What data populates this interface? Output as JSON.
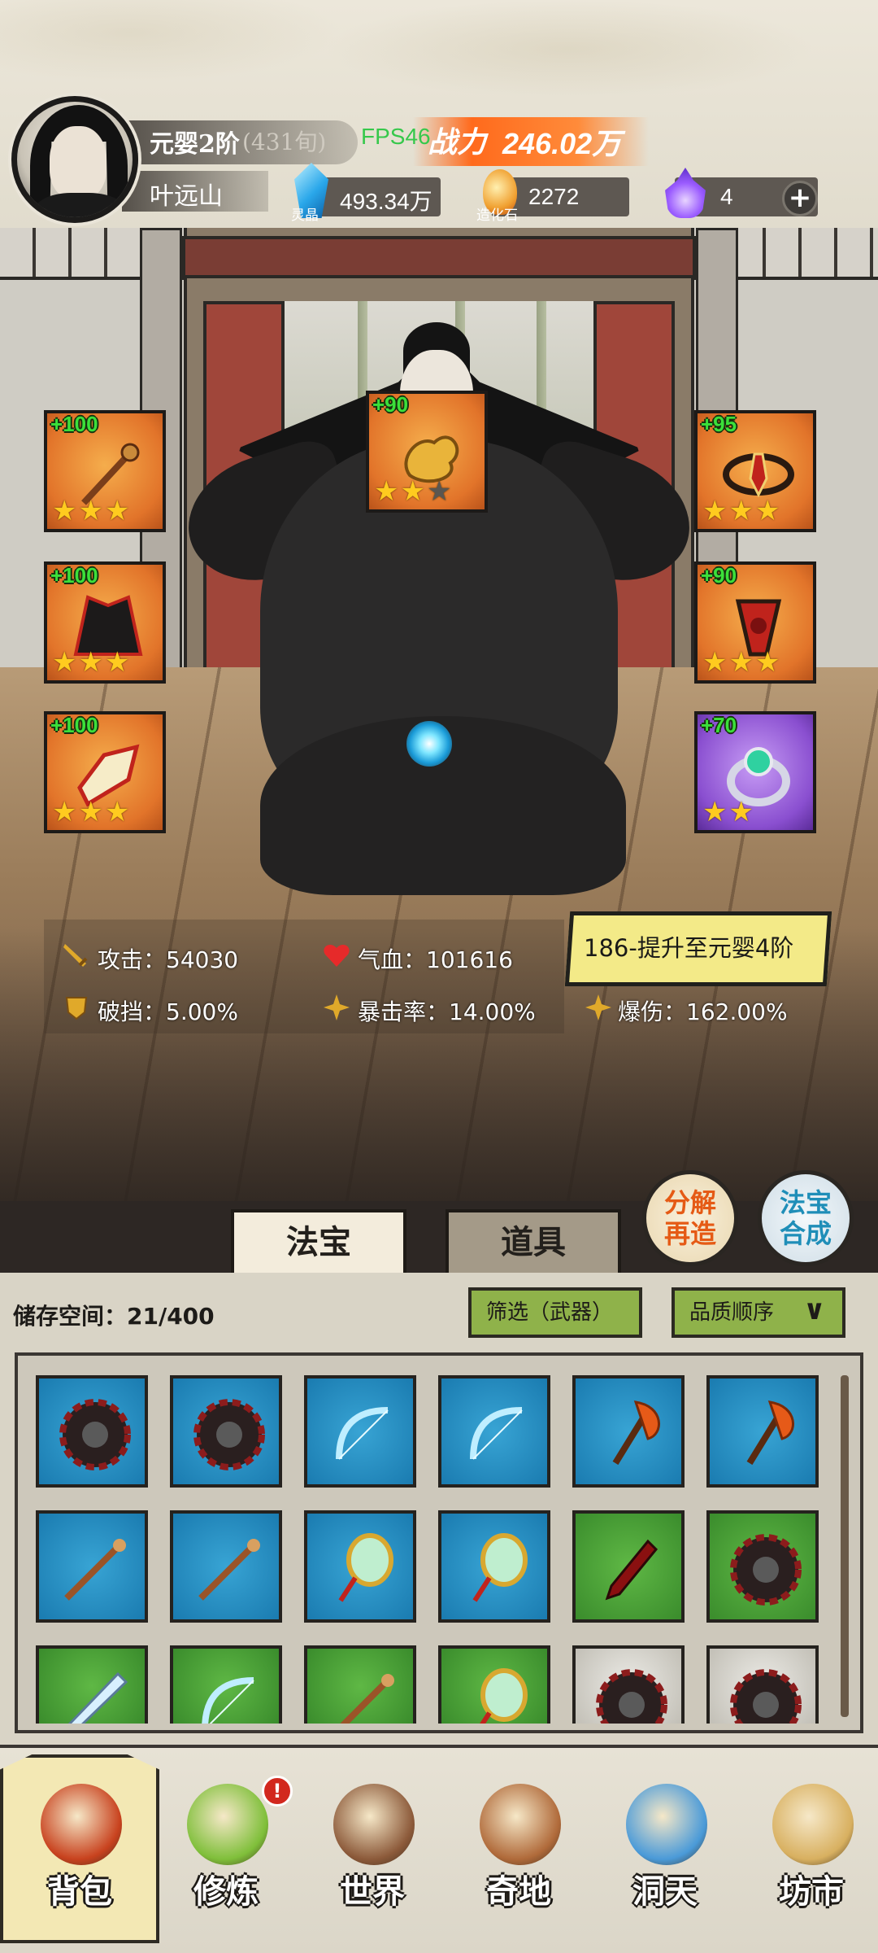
{
  "header": {
    "rank": "元婴2阶",
    "age": "(431旬)",
    "character_name": "叶远山",
    "fps": "FPS46",
    "power_label": "战力",
    "power_value": "246.02万",
    "resources": [
      {
        "icon": "spirit-crystal-icon",
        "caption": "灵晶",
        "value": "493.34万"
      },
      {
        "icon": "creation-stone-icon",
        "caption": "造化石",
        "value": "2272"
      },
      {
        "icon": "purple-flame-icon",
        "caption": "",
        "value": "4"
      }
    ],
    "add_label": "+"
  },
  "equipment": {
    "left": [
      {
        "level": "+100",
        "stars": 3,
        "max_stars": 3,
        "icon": "staff-icon"
      },
      {
        "level": "+100",
        "stars": 3,
        "max_stars": 3,
        "icon": "robe-icon"
      },
      {
        "level": "+100",
        "stars": 3,
        "max_stars": 3,
        "icon": "boots-icon"
      }
    ],
    "top": {
      "level": "+90",
      "stars": 2,
      "max_stars": 3,
      "icon": "golden-cloud-icon"
    },
    "right": [
      {
        "level": "+95",
        "stars": 3,
        "max_stars": 3,
        "icon": "crown-icon"
      },
      {
        "level": "+90",
        "stars": 3,
        "max_stars": 3,
        "icon": "amulet-icon"
      },
      {
        "level": "+70",
        "stars": 2,
        "max_stars": 2,
        "icon": "ring-icon"
      }
    ]
  },
  "stats": {
    "attack": "攻击：54030",
    "hp": "气血：101616",
    "break_block": "破挡：5.00%",
    "crit_rate": "暴击率：14.00%",
    "crit_dmg": "爆伤：162.00%"
  },
  "upgrade": {
    "label": "186-提升至元婴4阶"
  },
  "round_buttons": {
    "decompose": "分解\n再造",
    "synthesize": "法宝\n合成"
  },
  "tabs": {
    "treasure": "法宝",
    "items": "道具"
  },
  "bag": {
    "storage": "储存空间：21/400",
    "filter": "筛选（武器）",
    "sort": "品质顺序",
    "cells": [
      {
        "color": "blue",
        "icon": "dark-wheel-icon"
      },
      {
        "color": "blue",
        "icon": "dark-wheel-icon"
      },
      {
        "color": "blue",
        "icon": "ice-bow-icon"
      },
      {
        "color": "blue",
        "icon": "ice-bow-icon"
      },
      {
        "color": "blue",
        "icon": "fire-axe-icon"
      },
      {
        "color": "blue",
        "icon": "fire-axe-icon"
      },
      {
        "color": "blue",
        "icon": "bone-staff-icon"
      },
      {
        "color": "blue",
        "icon": "bone-staff-icon"
      },
      {
        "color": "blue",
        "icon": "jade-mirror-icon"
      },
      {
        "color": "blue",
        "icon": "jade-mirror-icon"
      },
      {
        "color": "green",
        "icon": "blood-dagger-icon"
      },
      {
        "color": "green",
        "icon": "dark-wheel-icon"
      },
      {
        "color": "green",
        "icon": "ice-sword-icon"
      },
      {
        "color": "green",
        "icon": "ice-bow-icon"
      },
      {
        "color": "green",
        "icon": "bone-staff-icon"
      },
      {
        "color": "green",
        "icon": "jade-mirror-icon"
      },
      {
        "color": "gray",
        "icon": "dark-wheel-icon"
      },
      {
        "color": "gray",
        "icon": "dark-wheel-icon"
      }
    ]
  },
  "nav": [
    {
      "label": "背包",
      "icon": "backpack-icon",
      "active": true,
      "badge": ""
    },
    {
      "label": "修炼",
      "icon": "cultivation-flower-icon",
      "active": false,
      "badge": "!"
    },
    {
      "label": "世界",
      "icon": "world-scroll-icon",
      "active": false,
      "badge": ""
    },
    {
      "label": "奇地",
      "icon": "mystic-land-icon",
      "active": false,
      "badge": ""
    },
    {
      "label": "洞天",
      "icon": "cave-portal-icon",
      "active": false,
      "badge": ""
    },
    {
      "label": "坊市",
      "icon": "market-icon",
      "active": false,
      "badge": ""
    }
  ],
  "colors": {
    "orange_slot": "#e2742a",
    "purple_slot": "#8a4fd0",
    "level_green": "#3be03a",
    "star_gold": "#ffcb1f",
    "upgrade_yellow": "#f3ea88",
    "filter_green": "#8fb24a"
  }
}
